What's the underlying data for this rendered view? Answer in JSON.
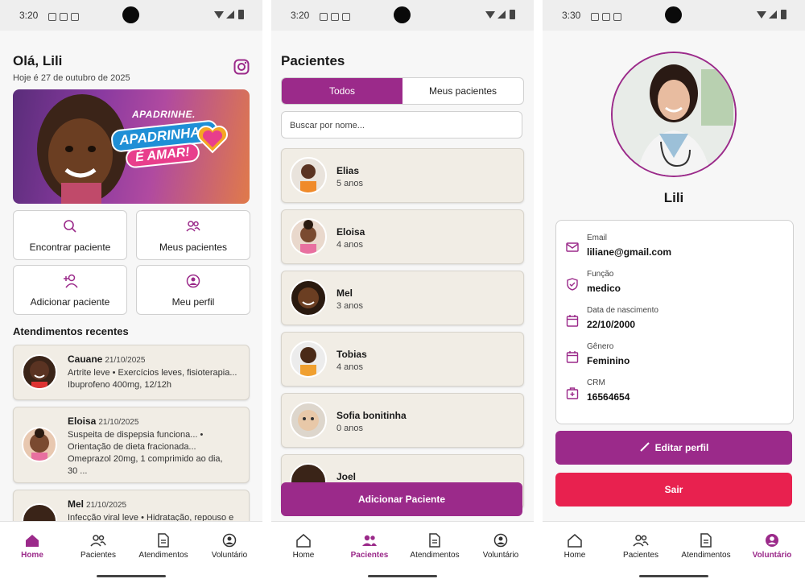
{
  "colors": {
    "accent": "#9b2a8a",
    "danger": "#e8214f",
    "card": "#f1ede5"
  },
  "home": {
    "status_time": "3:20",
    "greeting": "Olá, Lili",
    "date_line": "Hoje é 27 de outubro de 2025",
    "banner": {
      "line1": "APADRINHE.",
      "line2": "APADRINHAR",
      "line3": "É AMAR!"
    },
    "actions": [
      {
        "label": "Encontrar paciente",
        "icon": "search-icon"
      },
      {
        "label": "Meus pacientes",
        "icon": "users-icon"
      },
      {
        "label": "Adicionar paciente",
        "icon": "add-user-icon"
      },
      {
        "label": "Meu perfil",
        "icon": "profile-icon"
      }
    ],
    "recent_title": "Atendimentos recentes",
    "recent": [
      {
        "name": "Cauane",
        "date": "21/10/2025",
        "line1": "Artrite leve • Exercícios leves, fisioterapia...",
        "line2": "Ibuprofeno 400mg, 12/12h"
      },
      {
        "name": "Eloisa",
        "date": "21/10/2025",
        "line1": "Suspeita de dispepsia funciona... •",
        "line2": "Orientação de dieta fracionada...",
        "line3": "Omeprazol 20mg, 1 comprimido ao dia,",
        "line4": "30 ..."
      },
      {
        "name": "Mel",
        "date": "21/10/2025",
        "line1": "Infecção viral leve • Hidratação, repouso e"
      }
    ]
  },
  "patients": {
    "status_time": "3:20",
    "title": "Pacientes",
    "tabs": [
      "Todos",
      "Meus pacientes"
    ],
    "search_placeholder": "Buscar por nome...",
    "list": [
      {
        "name": "Elias",
        "age": "5 anos"
      },
      {
        "name": "Eloisa",
        "age": "4 anos"
      },
      {
        "name": "Mel",
        "age": "3 anos"
      },
      {
        "name": "Tobias",
        "age": "4 anos"
      },
      {
        "name": "Sofia bonitinha",
        "age": "0 anos"
      },
      {
        "name": "Joel",
        "age": ""
      }
    ],
    "add_button": "Adicionar Paciente"
  },
  "profile": {
    "status_time": "3:30",
    "name": "Lili",
    "fields": [
      {
        "label": "Email",
        "value": "liliane@gmail.com",
        "icon": "mail-icon"
      },
      {
        "label": "Função",
        "value": "medico",
        "icon": "shield-icon"
      },
      {
        "label": "Data de nascimento",
        "value": "22/10/2000",
        "icon": "calendar-icon"
      },
      {
        "label": "Gênero",
        "value": "Feminino",
        "icon": "calendar-icon"
      },
      {
        "label": "CRM",
        "value": "16564654",
        "icon": "medical-case-icon"
      }
    ],
    "edit_button": "Editar perfil",
    "logout_button": "Sair"
  },
  "nav": {
    "items": [
      "Home",
      "Pacientes",
      "Atendimentos",
      "Voluntário"
    ]
  }
}
